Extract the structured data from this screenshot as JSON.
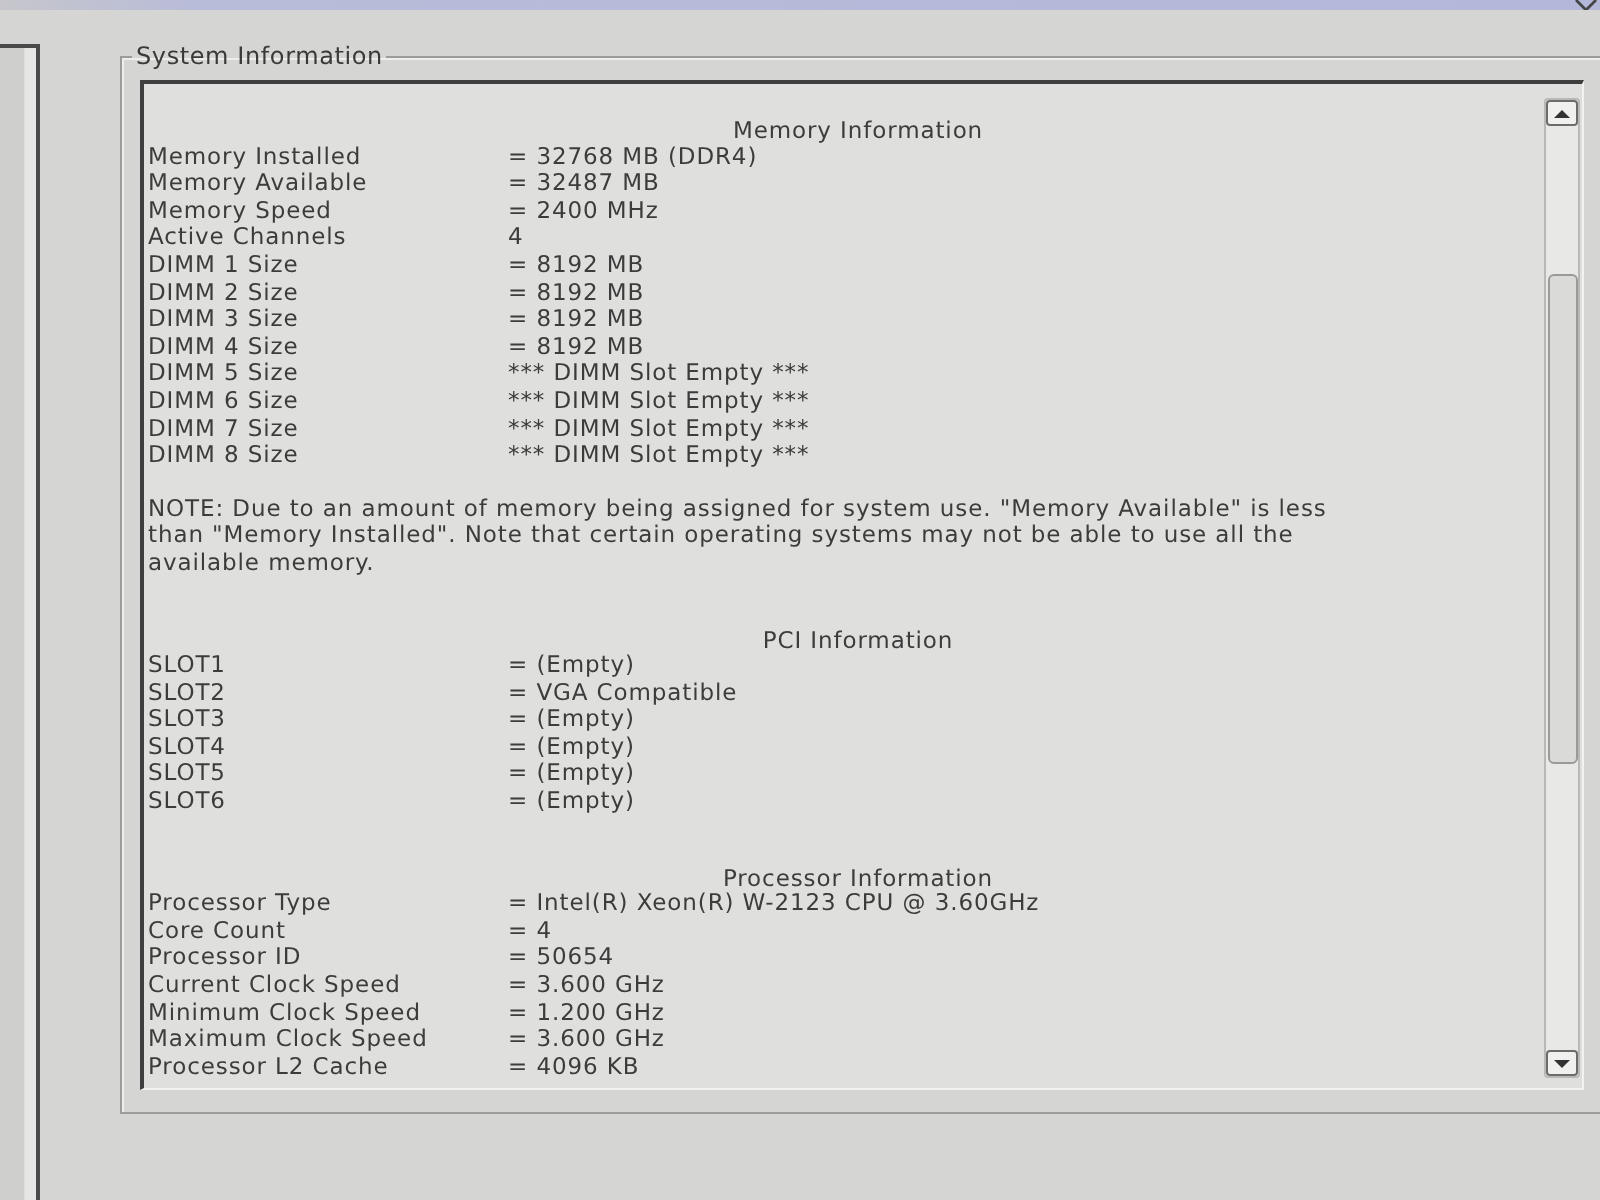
{
  "group": {
    "title": "System Information"
  },
  "sections": [
    {
      "heading": "Memory Information",
      "rows": [
        {
          "label": "Memory Installed",
          "value": "= 32768 MB (DDR4)"
        },
        {
          "label": "Memory Available",
          "value": "= 32487 MB"
        },
        {
          "label": "Memory Speed",
          "value": "= 2400 MHz"
        },
        {
          "label": "Active Channels",
          "value": "4"
        },
        {
          "label": "DIMM 1 Size",
          "value": "= 8192 MB"
        },
        {
          "label": "DIMM 2 Size",
          "value": "= 8192 MB"
        },
        {
          "label": "DIMM 3 Size",
          "value": "= 8192 MB"
        },
        {
          "label": "DIMM 4 Size",
          "value": "= 8192 MB"
        },
        {
          "label": "DIMM 5 Size",
          "value": "*** DIMM Slot Empty ***"
        },
        {
          "label": "DIMM 6 Size",
          "value": "*** DIMM Slot Empty ***"
        },
        {
          "label": "DIMM 7 Size",
          "value": "*** DIMM Slot Empty ***"
        },
        {
          "label": "DIMM 8 Size",
          "value": "*** DIMM Slot Empty ***"
        }
      ],
      "note": [
        "NOTE: Due to an amount of memory being assigned for system use. \"Memory Available\" is less",
        "than \"Memory Installed\". Note that certain operating systems may not be able to use all the",
        "available memory."
      ]
    },
    {
      "heading": "PCI Information",
      "rows": [
        {
          "label": "SLOT1",
          "value": "= (Empty)"
        },
        {
          "label": "SLOT2",
          "value": "= VGA Compatible"
        },
        {
          "label": "SLOT3",
          "value": "= (Empty)"
        },
        {
          "label": "SLOT4",
          "value": "= (Empty)"
        },
        {
          "label": "SLOT5",
          "value": "= (Empty)"
        },
        {
          "label": "SLOT6",
          "value": "= (Empty)"
        }
      ]
    },
    {
      "heading": "Processor Information",
      "rows": [
        {
          "label": "Processor Type",
          "value": "= Intel(R) Xeon(R) W-2123 CPU @ 3.60GHz"
        },
        {
          "label": "Core Count",
          "value": "= 4"
        },
        {
          "label": "Processor ID",
          "value": "= 50654"
        },
        {
          "label": "Current Clock Speed",
          "value": "= 3.600 GHz"
        },
        {
          "label": "Minimum Clock Speed",
          "value": "= 1.200 GHz"
        },
        {
          "label": "Maximum Clock Speed",
          "value": "= 3.600 GHz"
        },
        {
          "label": "Processor L2 Cache",
          "value": "= 4096 KB"
        }
      ]
    }
  ]
}
